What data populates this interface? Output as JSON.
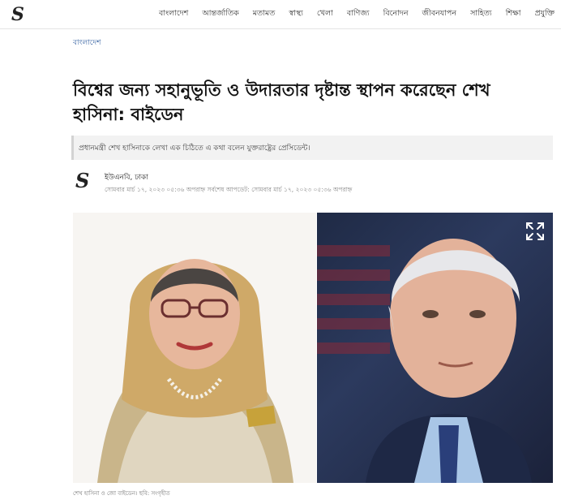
{
  "site": {
    "logo_text": "S"
  },
  "nav": {
    "items": [
      "বাংলাদেশ",
      "আন্তর্জাতিক",
      "মতামত",
      "স্বাস্থ্য",
      "খেলা",
      "বাণিজ্য",
      "বিনোদন",
      "জীবনযাপন",
      "সাহিত্য",
      "শিক্ষা",
      "প্রযুক্তি"
    ]
  },
  "article": {
    "section": "বাংলাদেশ",
    "headline": "বিশ্বের জন্য সহানুভূতি ও উদারতার দৃষ্টান্ত স্থাপন করেছেন শেখ হাসিনা: বাইডেন",
    "summary": "প্রধানমন্ত্রী শেখ হাসিনাকে লেখা এক চিঠিতে এ কথা বলেন যুক্তরাষ্ট্রের প্রেসিডেন্ট।",
    "author": "ইউএনবি, ঢাকা",
    "timestamp": "সোমবার মার্চ ১৭, ২০২৩ ০৫:৩৬ অপরাহ্ন সর্বশেষ আপডেট: সোমবার মার্চ ১৭, ২০২৩ ০৫:৩৬ অপরাহ্ন",
    "image_caption": "শেখ হাসিনা ও জো বাইডেন। ছবি: সংগৃহীত"
  },
  "icons": {
    "expand": "expand-icon",
    "logo": "site-logo-icon"
  },
  "colors": {
    "breadcrumb": "#2f5d9f",
    "summary_bg": "#f2f2f2"
  }
}
